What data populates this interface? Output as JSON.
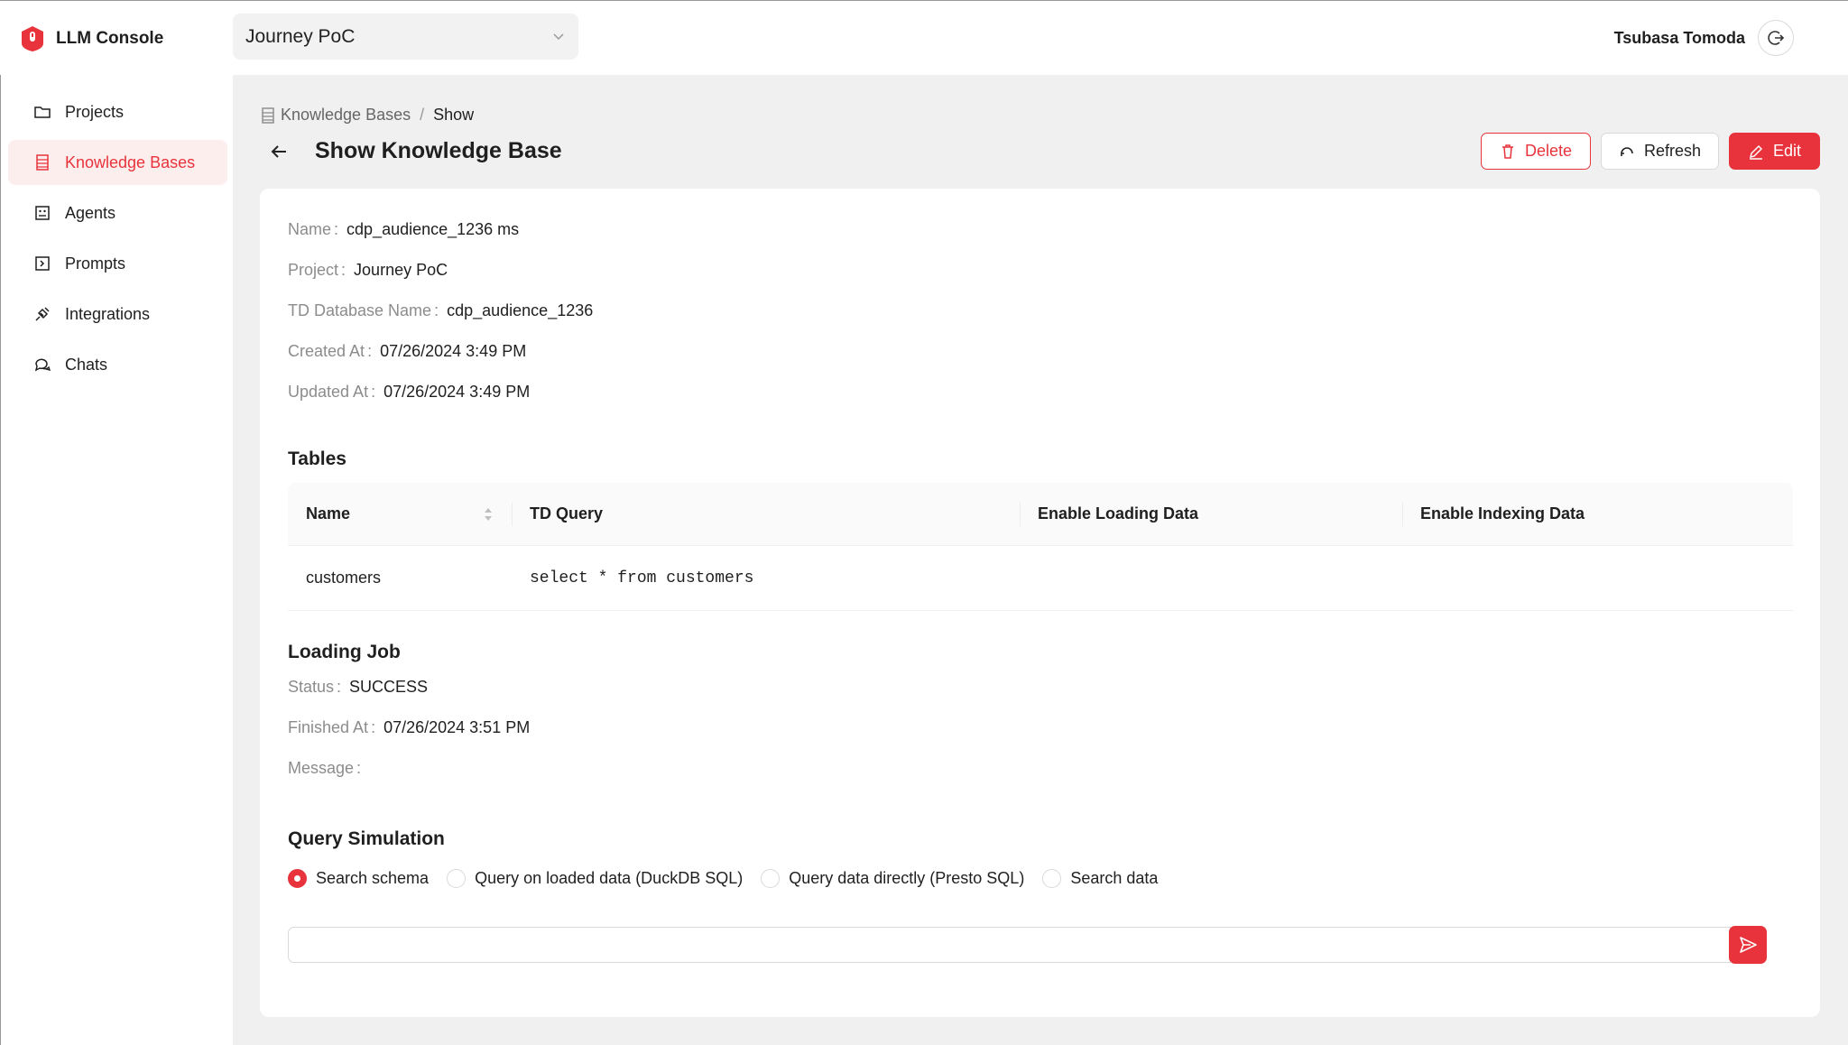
{
  "app": {
    "name": "LLM Console"
  },
  "header": {
    "project_select": {
      "value": "Journey PoC"
    },
    "user_name": "Tsubasa Tomoda"
  },
  "sidebar": {
    "items": [
      {
        "label": "Projects",
        "icon": "folder-icon",
        "active": false
      },
      {
        "label": "Knowledge Bases",
        "icon": "database-icon",
        "active": true
      },
      {
        "label": "Agents",
        "icon": "robot-icon",
        "active": false
      },
      {
        "label": "Prompts",
        "icon": "prompt-icon",
        "active": false
      },
      {
        "label": "Integrations",
        "icon": "plug-icon",
        "active": false
      },
      {
        "label": "Chats",
        "icon": "chat-icon",
        "active": false
      }
    ]
  },
  "breadcrumb": {
    "parent": "Knowledge Bases",
    "separator": "/",
    "current": "Show"
  },
  "page": {
    "title": "Show Knowledge Base"
  },
  "actions": {
    "delete": "Delete",
    "refresh": "Refresh",
    "edit": "Edit"
  },
  "details": [
    {
      "label": "Name",
      "value": "cdp_audience_1236 ms"
    },
    {
      "label": "Project",
      "value": "Journey PoC"
    },
    {
      "label": "TD Database Name",
      "value": "cdp_audience_1236"
    },
    {
      "label": "Created At",
      "value": "07/26/2024 3:49 PM"
    },
    {
      "label": "Updated At",
      "value": "07/26/2024 3:49 PM"
    }
  ],
  "tables_section": {
    "title": "Tables",
    "columns": [
      "Name",
      "TD Query",
      "Enable Loading Data",
      "Enable Indexing Data"
    ],
    "rows": [
      {
        "name": "customers",
        "td_query": "select * from customers",
        "enable_loading": "",
        "enable_indexing": ""
      }
    ]
  },
  "loading_job": {
    "title": "Loading Job",
    "fields": [
      {
        "label": "Status",
        "value": "SUCCESS"
      },
      {
        "label": "Finished At",
        "value": "07/26/2024 3:51 PM"
      },
      {
        "label": "Message",
        "value": ""
      }
    ]
  },
  "query_simulation": {
    "title": "Query Simulation",
    "options": [
      {
        "label": "Search schema",
        "checked": true
      },
      {
        "label": "Query on loaded data (DuckDB SQL)",
        "checked": false
      },
      {
        "label": "Query data directly (Presto SQL)",
        "checked": false
      },
      {
        "label": "Search data",
        "checked": false
      }
    ],
    "input_value": "",
    "input_placeholder": ""
  },
  "colors": {
    "accent": "#e8333c",
    "active_bg": "#fdeeee",
    "page_bg": "#f0f0f0"
  }
}
